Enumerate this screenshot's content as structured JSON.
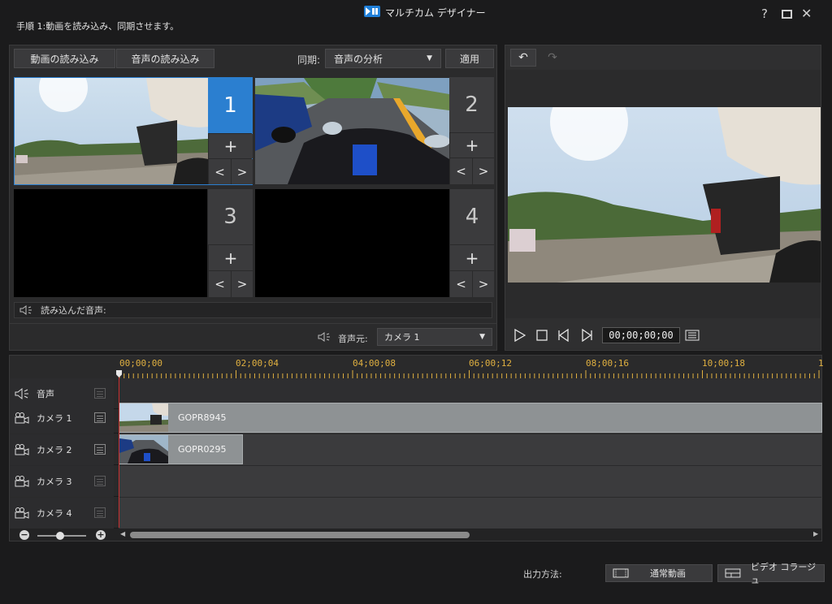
{
  "app": {
    "title": "マルチカム デザイナー",
    "step": "手順 1:動画を読み込み、同期させます。"
  },
  "window": {
    "help": "?",
    "maximize": "☐",
    "close": "✕"
  },
  "toolbar": {
    "import_video": "動画の読み込み",
    "import_audio": "音声の読み込み",
    "sync_label": "同期:",
    "sync_value": "音声の分析",
    "apply": "適用"
  },
  "cells": [
    {
      "num": "1",
      "selected": true
    },
    {
      "num": "2",
      "selected": false
    },
    {
      "num": "3",
      "selected": false
    },
    {
      "num": "4",
      "selected": false
    }
  ],
  "glyphs": {
    "add": "+",
    "prev": "<",
    "next": ">"
  },
  "imported_audio_label": "読み込んだ音声:",
  "audio_source": {
    "label": "音声元:",
    "value": "カメラ 1"
  },
  "preview": {
    "undo": "↶",
    "redo": "↷",
    "timecode": "00;00;00;00"
  },
  "timeline": {
    "ticks": [
      "00;00;00",
      "02;00;04",
      "04;00;08",
      "06;00;12",
      "08;00;16",
      "10;00;18",
      "1"
    ],
    "tracks": [
      {
        "label": "音声",
        "icon": "speaker-icon"
      },
      {
        "label": "カメラ 1",
        "icon": "camera-icon"
      },
      {
        "label": "カメラ 2",
        "icon": "camera-icon"
      },
      {
        "label": "カメラ 3",
        "icon": "camera-icon"
      },
      {
        "label": "カメラ 4",
        "icon": "camera-icon"
      }
    ],
    "clips": [
      {
        "track": 1,
        "name": "GOPR8945"
      },
      {
        "track": 2,
        "name": "GOPR0295"
      }
    ],
    "zoom": {
      "minus": "−",
      "plus": "+"
    }
  },
  "output": {
    "label": "出力方法:",
    "normal": "通常動画",
    "collage": "ビデオ コラージュ"
  },
  "colors": {
    "accent": "#2b7fd0",
    "playhead": "#c83030",
    "ruler": "#e0b040"
  }
}
